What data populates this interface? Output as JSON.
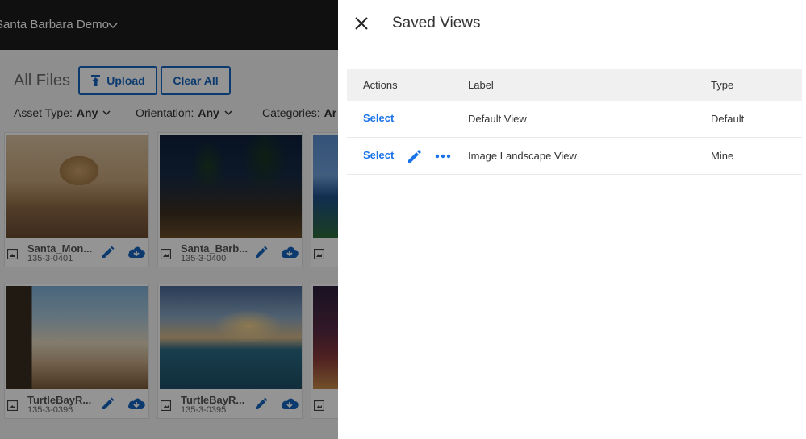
{
  "app": {
    "org_name": "Santa Barbara Demo",
    "files_title": "All Files",
    "upload_label": "Upload",
    "clear_all_label": "Clear All",
    "filters": [
      {
        "label": "Asset Type:",
        "value": "Any"
      },
      {
        "label": "Orientation:",
        "value": "Any"
      },
      {
        "label": "Categories:",
        "value": "Ar"
      }
    ],
    "cards": [
      {
        "name": "Santa_Mon...",
        "code": "135-3-0401"
      },
      {
        "name": "Santa_Barb...",
        "code": "135-3-0400"
      },
      {
        "name": "",
        "code": ""
      },
      {
        "name": "TurtleBayR...",
        "code": "135-3-0396"
      },
      {
        "name": "TurtleBayR...",
        "code": "135-3-0395"
      },
      {
        "name": "",
        "code": ""
      }
    ]
  },
  "panel": {
    "title": "Saved Views",
    "columns": {
      "actions": "Actions",
      "label": "Label",
      "type": "Type"
    },
    "rows": [
      {
        "select": "Select",
        "label": "Default View",
        "type": "Default"
      },
      {
        "select": "Select",
        "label": "Image Landscape View",
        "type": "Mine"
      }
    ]
  },
  "colors": {
    "accent": "#1a73e8",
    "topbar": "#1d1d1d",
    "button_blue": "#1565c0"
  }
}
